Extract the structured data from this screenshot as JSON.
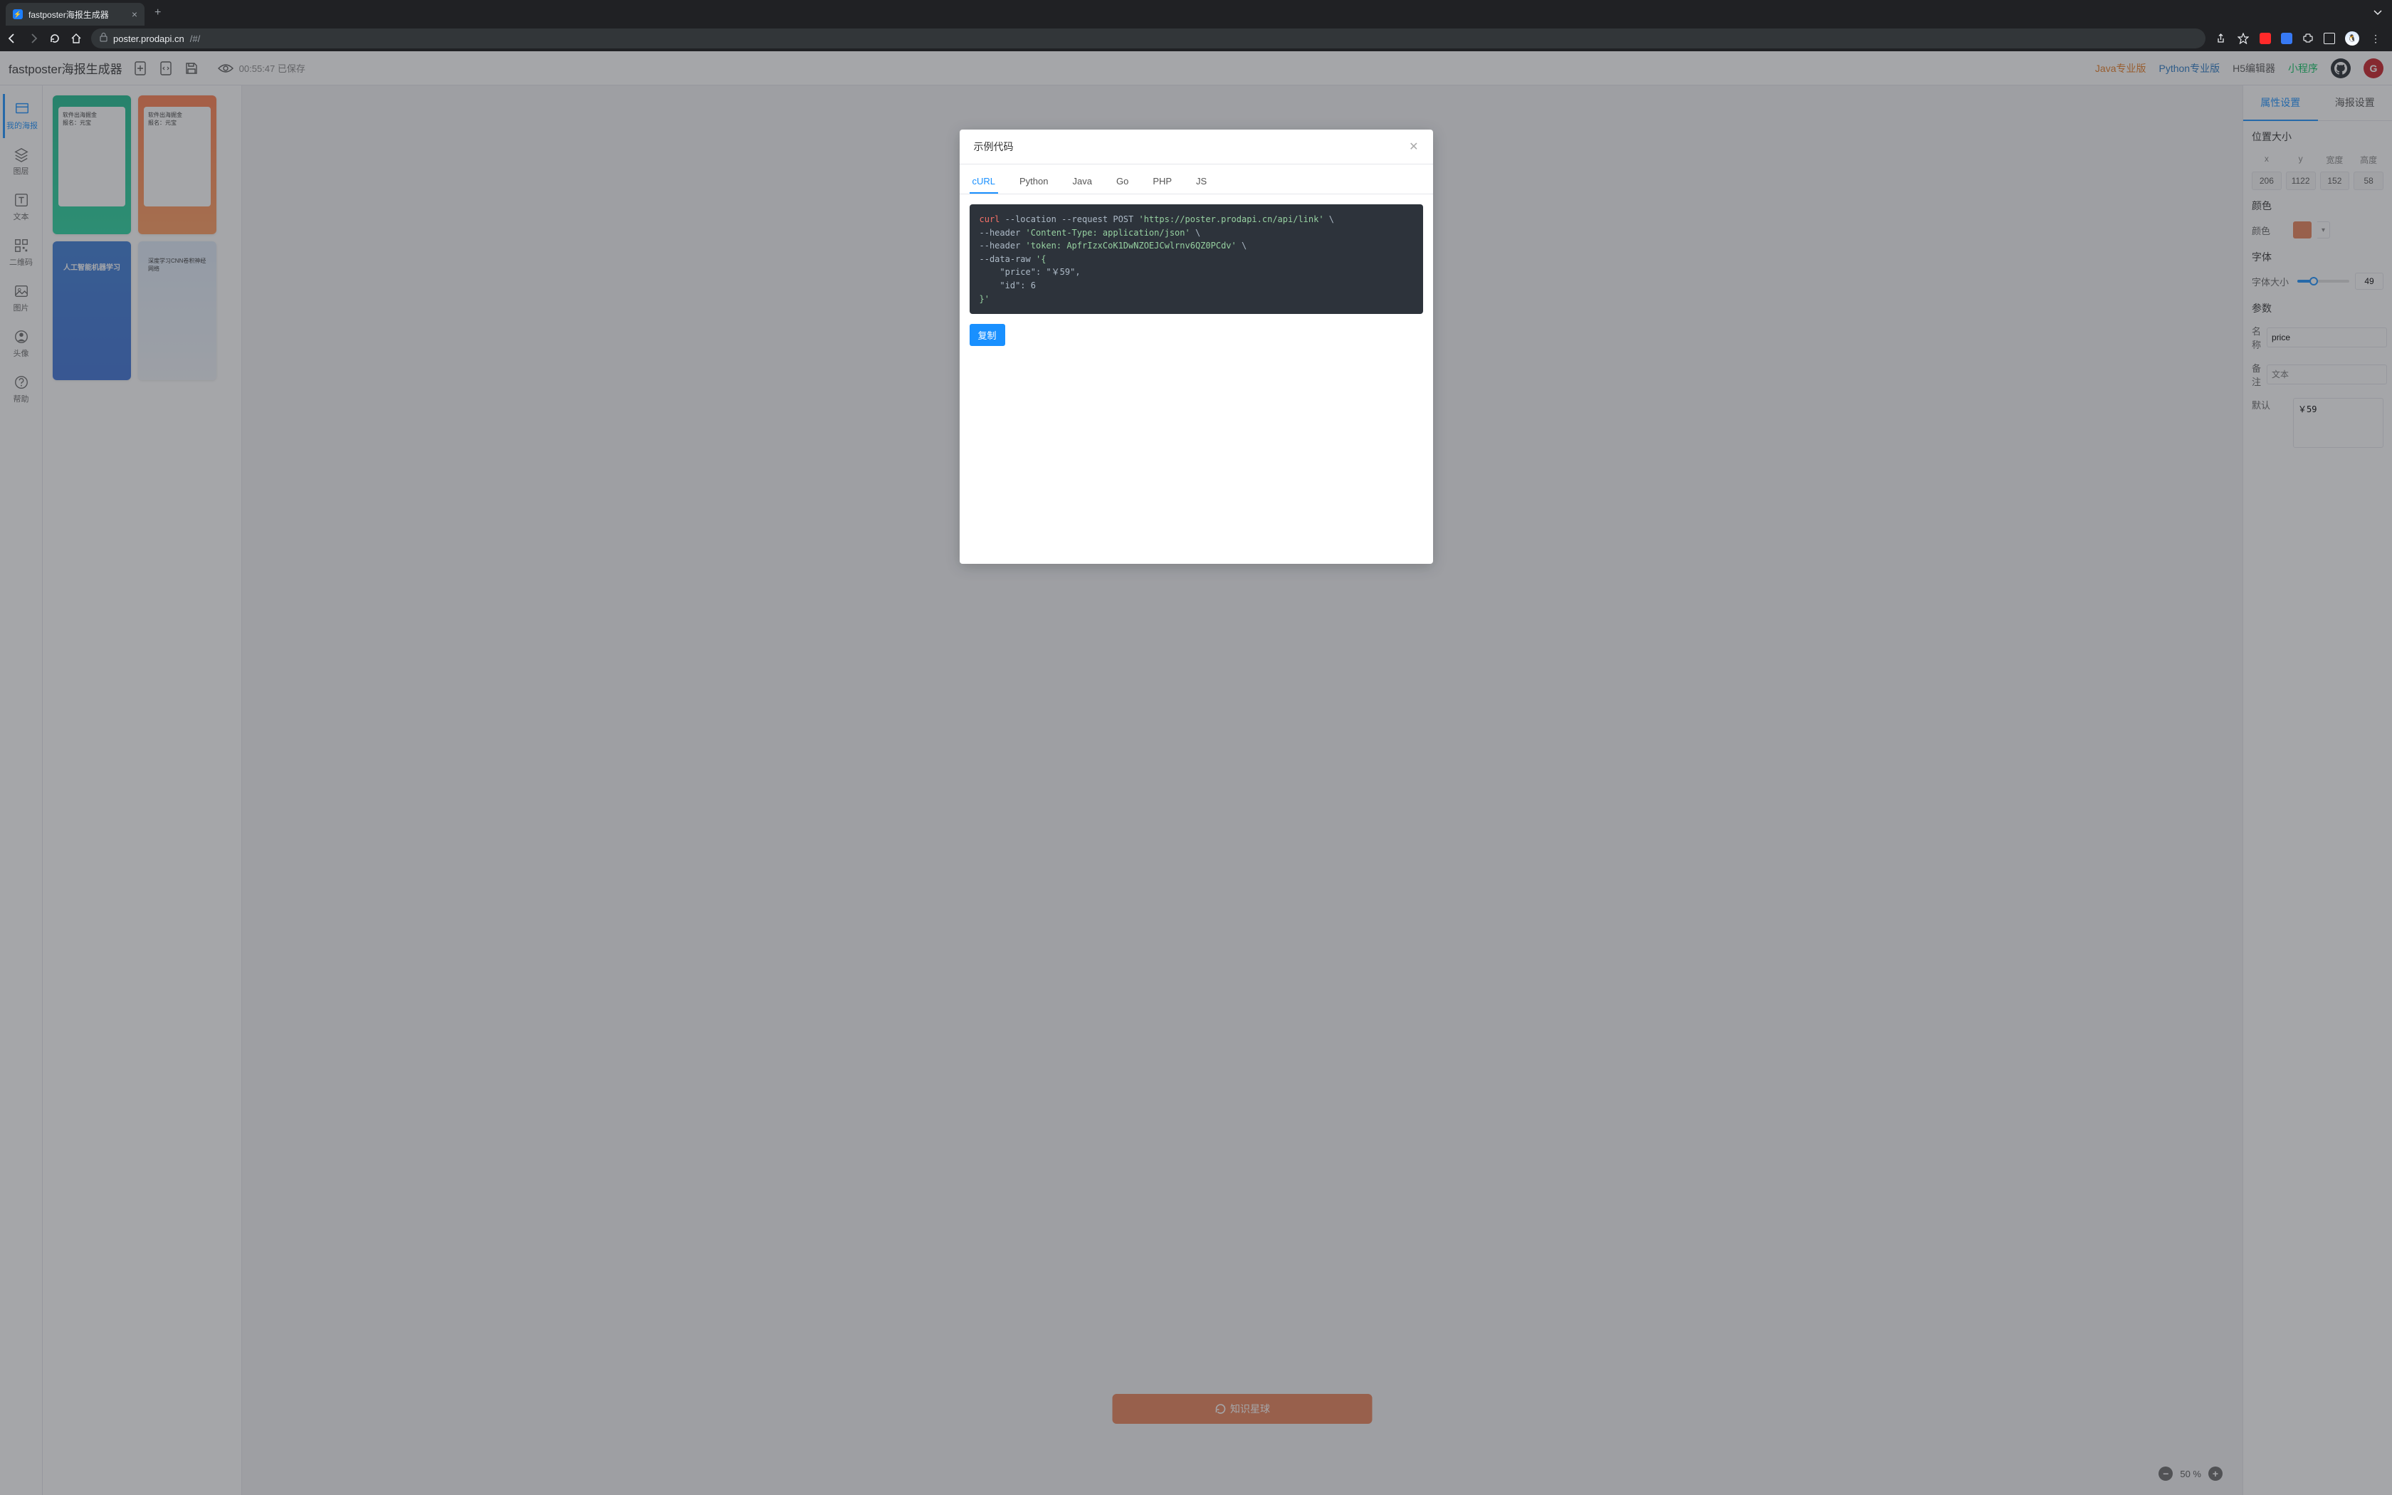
{
  "browser": {
    "tab_title": "fastposter海报生成器",
    "url_domain": "poster.prodapi.cn",
    "url_path": "/#/"
  },
  "topbar": {
    "app_title": "fastposter海报生成器",
    "saved_time": "00:55:47 已保存",
    "links": {
      "java": "Java专业版",
      "python": "Python专业版",
      "h5": "H5编辑器",
      "miniprogram": "小程序"
    }
  },
  "sidebar": {
    "items": [
      {
        "label": "我的海报"
      },
      {
        "label": "图层"
      },
      {
        "label": "文本"
      },
      {
        "label": "二维码"
      },
      {
        "label": "图片"
      },
      {
        "label": "头像"
      },
      {
        "label": "帮助"
      }
    ]
  },
  "zsxq_label": "知识星球",
  "zoom": {
    "pct": "50 %"
  },
  "right_panel": {
    "tabs": {
      "attr": "属性设置",
      "poster": "海报设置"
    },
    "pos_title": "位置大小",
    "pos_labels": {
      "x": "x",
      "y": "y",
      "w": "宽度",
      "h": "高度"
    },
    "pos_values": {
      "x": "206",
      "y": "1122",
      "w": "152",
      "h": "58"
    },
    "color_title": "颜色",
    "color_label": "颜色",
    "font_title": "字体",
    "font_size_label": "字体大小",
    "font_size_value": "49",
    "params_title": "参数",
    "name_label": "名称",
    "name_value": "price",
    "remark_label": "备注",
    "remark_placeholder": "文本",
    "default_label": "默认",
    "default_value": "￥59"
  },
  "modal": {
    "title": "示例代码",
    "tabs": [
      "cURL",
      "Python",
      "Java",
      "Go",
      "PHP",
      "JS"
    ],
    "code_kw1": "curl",
    "code_l1a": " --location --request POST ",
    "code_s1": "'https://poster.prodapi.cn/api/link'",
    "code_l1b": " \\",
    "code_l2a": "--header ",
    "code_s2": "'Content-Type: application/json'",
    "code_l2b": " \\",
    "code_l3a": "--header ",
    "code_s3": "'token: ApfrIzxCoK1DwNZOEJCwlrnv6QZ0PCdv'",
    "code_l3b": " \\",
    "code_l4a": "--data-raw ",
    "code_s4": "'{",
    "code_l5": "    \"price\": \"￥59\",",
    "code_l6": "    \"id\": 6",
    "code_s7": "}'",
    "copy_label": "复制"
  }
}
